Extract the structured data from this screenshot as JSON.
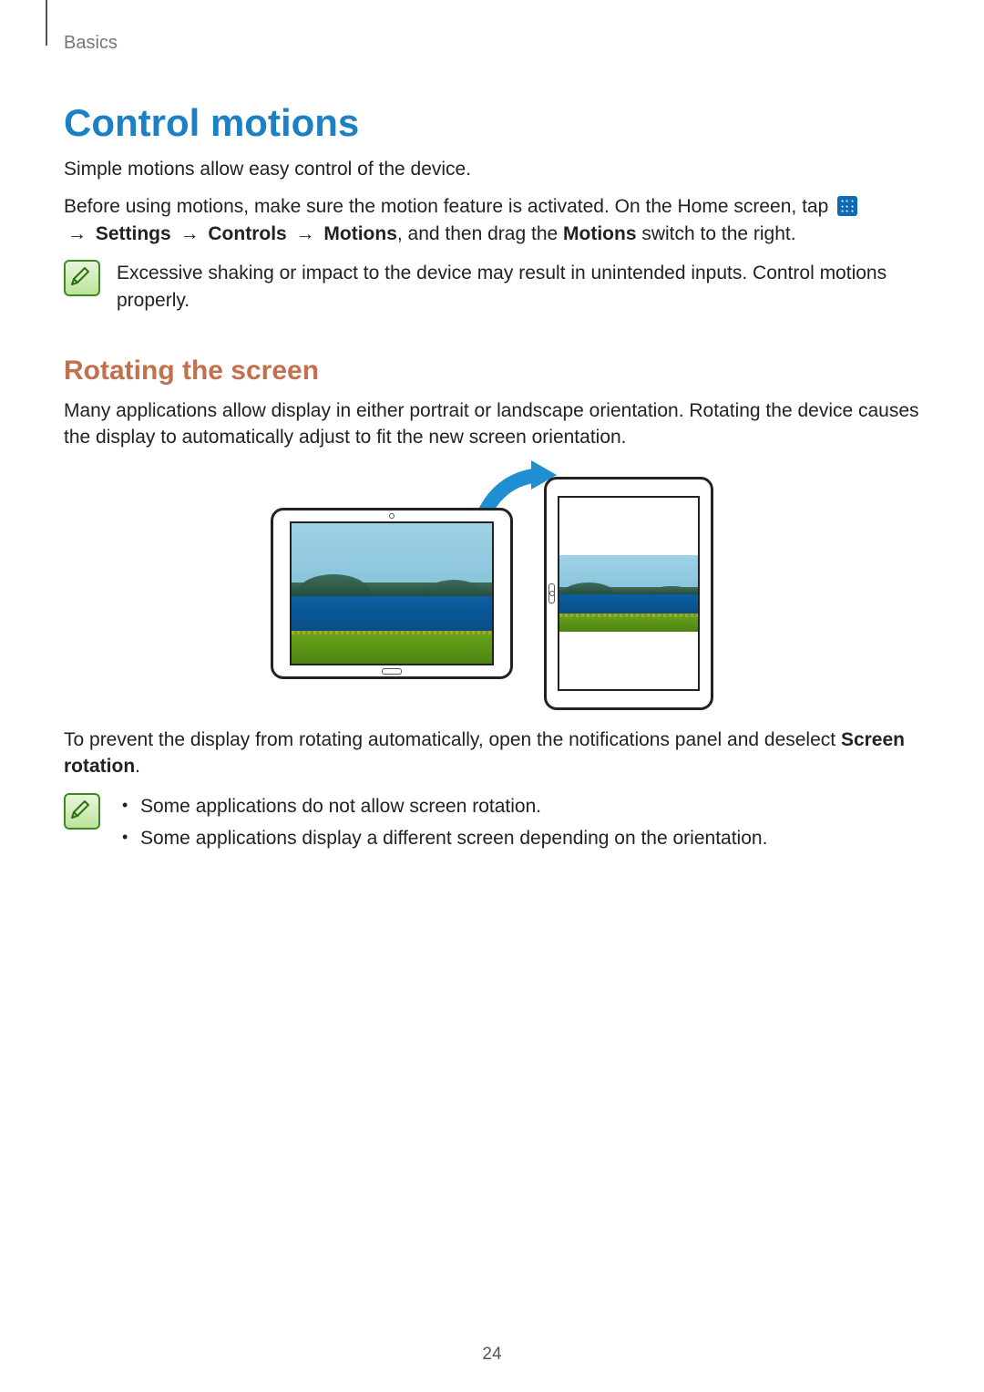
{
  "breadcrumb": "Basics",
  "title": "Control motions",
  "intro_p1": "Simple motions allow easy control of the device.",
  "intro_p2_pre": "Before using motions, make sure the motion feature is activated. On the Home screen, tap ",
  "path": {
    "arrow": "→",
    "settings": "Settings",
    "controls": "Controls",
    "motions_menu": "Motions",
    "tail1": ", and then drag the ",
    "motions_switch": "Motions",
    "tail2": " switch to the right."
  },
  "note1": "Excessive shaking or impact to the device may result in unintended inputs. Control motions properly.",
  "subsection": "Rotating the screen",
  "sub_p1": "Many applications allow display in either portrait or landscape orientation. Rotating the device causes the display to automatically adjust to fit the new screen orientation.",
  "sub_p2_pre": "To prevent the display from rotating automatically, open the notifications panel and deselect ",
  "sub_p2_bold": "Screen rotation",
  "sub_p2_post": ".",
  "note2": {
    "items": [
      "Some applications do not allow screen rotation.",
      "Some applications display a different screen depending on the orientation."
    ]
  },
  "page_number": "24"
}
